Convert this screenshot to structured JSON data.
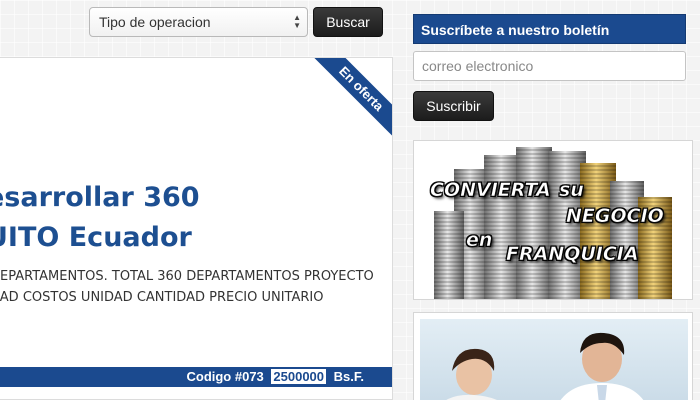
{
  "search": {
    "select_value": "Tipo de operacion",
    "button_label": "Buscar"
  },
  "listing": {
    "ribbon": "En oferta",
    "title_line1": "esarrollar 360",
    "title_line2": "UITO Ecuador",
    "desc_line1": "DEPARTAMENTOS. TOTAL 360 DEPARTAMENTOS PROYECTO",
    "desc_line2": "DAD COSTOS UNIDAD CANTIDAD PRECIO UNITARIO",
    "code_label": "Codigo #073",
    "price": "2500000",
    "currency": "Bs.F."
  },
  "newsletter": {
    "title": "Suscríbete a nuestro boletín",
    "email_placeholder": "correo electronico",
    "button_label": "Suscribir"
  },
  "banner": {
    "word1": "CONVIERTA",
    "word2": "su",
    "word3": "NEGOCIO",
    "word4": "en",
    "word5": "FRANQUICIA"
  },
  "colors": {
    "brand_blue": "#1b4a8f",
    "button_dark": "#222222"
  }
}
